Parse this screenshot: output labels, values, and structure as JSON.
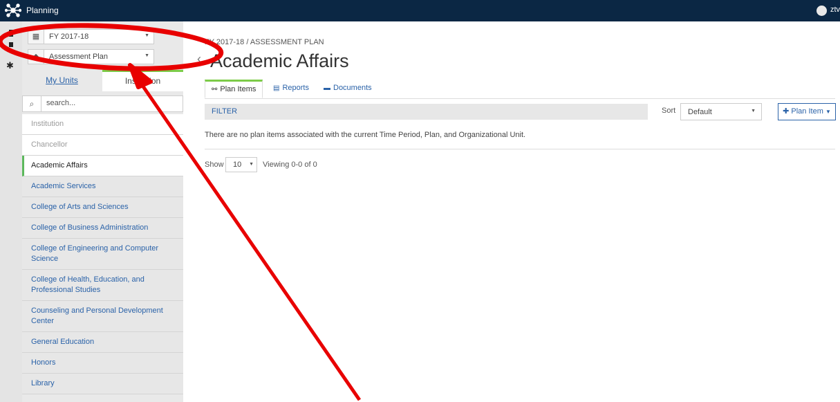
{
  "topbar": {
    "app_title": "Planning",
    "user": "ztv"
  },
  "sidebar": {
    "time_period": "FY 2017-18",
    "plan": "Assessment Plan",
    "tabs": {
      "my_units": "My Units",
      "institution": "Institution"
    },
    "search_placeholder": "search...",
    "units": [
      {
        "label": "Institution",
        "state": "muted"
      },
      {
        "label": "Chancellor",
        "state": "muted"
      },
      {
        "label": "Academic Affairs",
        "state": "active"
      },
      {
        "label": "Academic Services",
        "state": "link"
      },
      {
        "label": "College of Arts and Sciences",
        "state": "link"
      },
      {
        "label": "College of Business Administration",
        "state": "link"
      },
      {
        "label": "College of Engineering and Computer Science",
        "state": "link"
      },
      {
        "label": "College of Health, Education, and Professional Studies",
        "state": "link"
      },
      {
        "label": "Counseling and Personal Development Center",
        "state": "link"
      },
      {
        "label": "General Education",
        "state": "link"
      },
      {
        "label": "Honors",
        "state": "link"
      },
      {
        "label": "Library",
        "state": "link"
      }
    ]
  },
  "main": {
    "breadcrumb": "FY 2017-18 / ASSESSMENT PLAN",
    "title": "Academic Affairs",
    "tabs": [
      "Plan Items",
      "Reports",
      "Documents"
    ],
    "filter_label": "FILTER",
    "sort_label": "Sort",
    "sort_value": "Default",
    "add_button": "Plan Item",
    "empty_message": "There are no plan items associated with the current Time Period, Plan, and Organizational Unit.",
    "show_label": "Show",
    "page_size": "10",
    "viewing": "Viewing 0-0 of 0"
  },
  "colors": {
    "navbar": "#0b2744",
    "accent_green": "#7ccb48",
    "link_blue": "#2a62a8",
    "annotation_red": "#e80000"
  }
}
